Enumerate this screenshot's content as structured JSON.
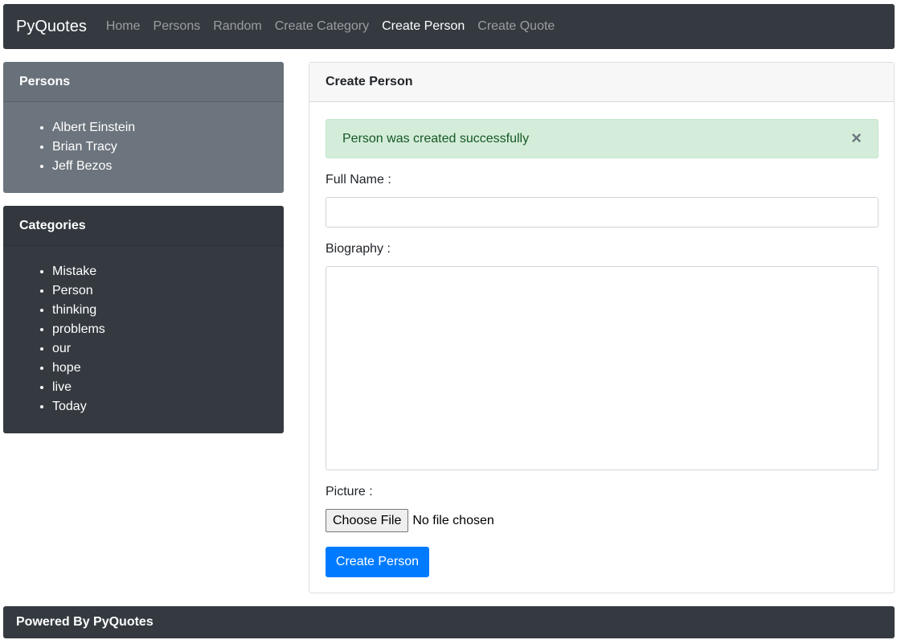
{
  "navbar": {
    "brand": "PyQuotes",
    "links": [
      {
        "label": "Home",
        "active": false
      },
      {
        "label": "Persons",
        "active": false
      },
      {
        "label": "Random",
        "active": false
      },
      {
        "label": "Create Category",
        "active": false
      },
      {
        "label": "Create Person",
        "active": true
      },
      {
        "label": "Create Quote",
        "active": false
      }
    ]
  },
  "sidebar": {
    "persons": {
      "title": "Persons",
      "items": [
        "Albert Einstein",
        "Brian Tracy",
        "Jeff Bezos"
      ]
    },
    "categories": {
      "title": "Categories",
      "items": [
        "Mistake",
        "Person",
        "thinking",
        "problems",
        "our",
        "hope",
        "live",
        "Today"
      ]
    }
  },
  "main": {
    "title": "Create Person",
    "alert": {
      "message": "Person was created successfully",
      "close_symbol": "×"
    },
    "form": {
      "full_name_label": "Full Name :",
      "full_name_value": "",
      "biography_label": "Biography :",
      "biography_value": "",
      "picture_label": "Picture :",
      "choose_file_label": "Choose File",
      "file_status": "No file chosen",
      "submit_label": "Create Person"
    }
  },
  "footer": {
    "text": "Powered By PyQuotes"
  },
  "colors": {
    "navbar_bg": "#343a40",
    "persons_card_bg": "#6c757d",
    "categories_card_bg": "#343a40",
    "alert_bg": "#d4edda",
    "alert_text": "#155724",
    "primary": "#007bff"
  }
}
